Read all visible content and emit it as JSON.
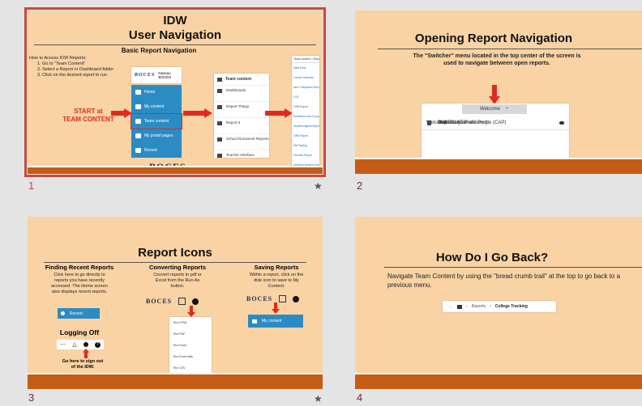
{
  "slides": [
    {
      "number": "1",
      "title_line1": "IDW",
      "title_line2": "User Navigation",
      "subtitle": "Basic Report Navigation",
      "howto_heading": "How to Access IDW Reports:",
      "howto_steps": [
        "1. Go to \"Team Content\"",
        "2. Select a Report or Dashboard folder",
        "3. Click on the desired report to run"
      ],
      "start_label_1": "START at",
      "start_label_2": "TEAM CONTENT",
      "nav_header": "Nassau BOCES",
      "nav_items": [
        "Home",
        "My content",
        "Team content",
        "My portal pages",
        "Recent"
      ],
      "folder_header": "Team content",
      "folder_items": [
        "Dashboards",
        "Report Things",
        "Report It",
        "School Document Reports",
        "Teacher Interface"
      ],
      "report_list_header": "Team content > Report",
      "report_items": [
        "Data Entry",
        "Course Selection",
        "Item Completion Report",
        "CSV",
        "ORB Report",
        "Enrollment and Completion Report",
        "Student Digital Report",
        "ORB Report",
        "Mel Testing",
        "Enrolled Report",
        "Demand Student Growth"
      ],
      "logo": "BOCES"
    },
    {
      "number": "2",
      "title": "Opening Report Navigation",
      "desc": "The \"Switcher\" menu located in the top center of the screen is used to navigate between open reports.",
      "switcher_label": "Welcome",
      "menu_items": [
        "Welcome",
        "Child Assessment Profile (CAP)",
        "NYSESLAT Proficiency",
        "Gap",
        "Item Analysis"
      ]
    },
    {
      "number": "3",
      "title": "Report Icons",
      "col1_heading": "Finding Recent Reports",
      "col1_text": "Click here to go directly to reports you have recently accessed. The Home screen also displays recent reports.",
      "recent_button": "Recent",
      "logoff_heading": "Logging Off",
      "logoff_text": "Go here to sign out of the IDW.",
      "col2_heading": "Converting Reports",
      "col2_text": "Convert reports to pdf or Excel from the Run As button.",
      "convert_items": [
        "Run HTML",
        "Run PDF",
        "Run Excel",
        "Run Excel data",
        "Run CSV"
      ],
      "col3_heading": "Saving Reports",
      "col3_text": "Within a report, click on the disk icon to save to My Content.",
      "save_button": "My content",
      "logo": "BOCES"
    },
    {
      "number": "4",
      "title": "How Do I Go Back?",
      "desc": "Navigate Team Content by using the \"bread crumb trail\" at the top to go back to a previous menu.",
      "breadcrumb_1": "Reports",
      "breadcrumb_2": "College Tracking"
    }
  ],
  "star": "★",
  "colors": {
    "slide_bg": "#f9d3a4",
    "footer": "#c55c16",
    "selection": "#c94a36",
    "accent_red": "#e02a1b",
    "nav_blue": "#2b8cc4"
  }
}
